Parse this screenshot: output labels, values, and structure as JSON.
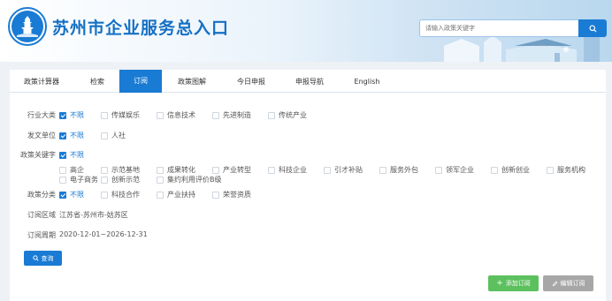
{
  "header": {
    "title": "苏州市企业服务总入口",
    "search_placeholder": "请输入政策关键字",
    "logo_caption": "Su zhou"
  },
  "tabs": [
    {
      "label": "政策计算器",
      "active": false
    },
    {
      "label": "检索",
      "active": false
    },
    {
      "label": "订阅",
      "active": true
    },
    {
      "label": "政策图解",
      "active": false
    },
    {
      "label": "今日申报",
      "active": false
    },
    {
      "label": "申报导航",
      "active": false
    },
    {
      "label": "English",
      "active": false
    }
  ],
  "filters": {
    "industry": {
      "label": "行业大类",
      "options": [
        {
          "label": "不限",
          "checked": true
        },
        {
          "label": "传媒娱乐",
          "checked": false
        },
        {
          "label": "信息技术",
          "checked": false
        },
        {
          "label": "先进制造",
          "checked": false
        },
        {
          "label": "传统产业",
          "checked": false
        }
      ]
    },
    "issuer": {
      "label": "发文单位",
      "options": [
        {
          "label": "不限",
          "checked": true
        },
        {
          "label": "人社",
          "checked": false
        }
      ]
    },
    "keywords": {
      "label": "政策关键字",
      "options": [
        {
          "label": "不限",
          "checked": true
        },
        {
          "label": "高企",
          "checked": false
        },
        {
          "label": "示范基地",
          "checked": false
        },
        {
          "label": "成果转化",
          "checked": false
        },
        {
          "label": "产业转型",
          "checked": false
        },
        {
          "label": "科技企业",
          "checked": false
        },
        {
          "label": "引才补贴",
          "checked": false
        },
        {
          "label": "服务外包",
          "checked": false
        },
        {
          "label": "领军企业",
          "checked": false
        },
        {
          "label": "创新创业",
          "checked": false
        },
        {
          "label": "服务机构",
          "checked": false
        },
        {
          "label": "电子商务",
          "checked": false
        },
        {
          "label": "创新示范",
          "checked": false
        },
        {
          "label": "集约利用评价B级",
          "checked": false
        }
      ]
    },
    "category": {
      "label": "政策分类",
      "options": [
        {
          "label": "不限",
          "checked": true
        },
        {
          "label": "科技合作",
          "checked": false
        },
        {
          "label": "产业扶持",
          "checked": false
        },
        {
          "label": "荣誉资质",
          "checked": false
        }
      ]
    },
    "region": {
      "label": "订阅区域",
      "value": "江苏省-苏州市-姑苏区"
    },
    "period": {
      "label": "订阅周期",
      "value": "2020-12-01~2026-12-31"
    }
  },
  "buttons": {
    "query": "查询",
    "add_subscription": "添加订阅",
    "edit_subscription": "编辑订阅"
  },
  "colors": {
    "primary": "#1a7bd4",
    "success": "#5cc05e",
    "muted": "#a7a7a7"
  }
}
